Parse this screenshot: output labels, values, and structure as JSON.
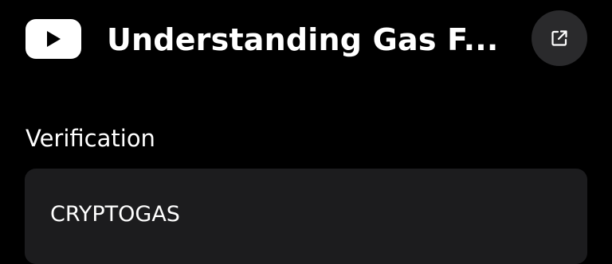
{
  "header": {
    "logo_icon": "youtube-icon",
    "title": "Understanding Gas F...",
    "open_external_icon": "external-link-icon"
  },
  "verification": {
    "label": "Verification",
    "value": "CRYPTOGAS"
  },
  "colors": {
    "background": "#000000",
    "field_background": "#1c1c1e",
    "button_background": "#2a2a2c",
    "text": "#ffffff"
  }
}
